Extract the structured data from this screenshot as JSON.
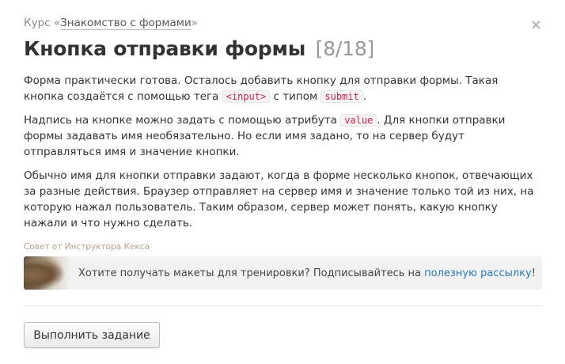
{
  "header": {
    "course_prefix": "Курс «",
    "course_name": "Знакомство с формами",
    "course_suffix": "»",
    "title": "Кнопка отправки формы",
    "progress": "[8/18]",
    "close_symbol": "×"
  },
  "content": {
    "p1": {
      "text1": "Форма практически готова. Осталось добавить кнопку для отправки формы. Такая кнопка создаётся с помощью тега ",
      "code1": "<input>",
      "text2": " с типом ",
      "code2": "submit",
      "text3": "."
    },
    "p2": {
      "text1": "Надпись на кнопке можно задать с помощью атрибута ",
      "code1": "value",
      "text2": ". Для кнопки отправки формы задавать имя необязательно. Но если имя задано, то на сервер будут отправляться имя и значение кнопки."
    },
    "p3": "Обычно имя для кнопки отправки задают, когда в форме несколько кнопок, отвечающих за разные действия. Браузер отправляет на сервер имя и значение только той из них, на которую нажал пользователь. Таким образом, сервер может понять, какую кнопку нажали и что нужно сделать."
  },
  "tip": {
    "label": "Совет от Инструктора Кекса",
    "text": "Хотите получать макеты для тренировки? Подписывайтесь на ",
    "link": "полезную рассылку",
    "suffix": "!"
  },
  "actions": {
    "submit_label": "Выполнить задание"
  }
}
